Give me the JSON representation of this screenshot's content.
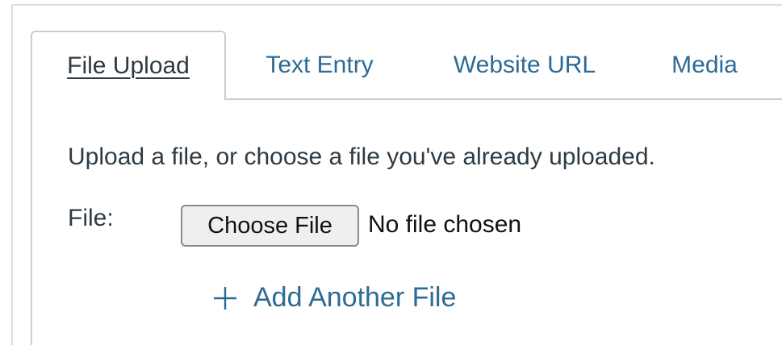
{
  "tabs": [
    {
      "label": "File Upload",
      "active": true
    },
    {
      "label": "Text Entry",
      "active": false
    },
    {
      "label": "Website URL",
      "active": false
    },
    {
      "label": "Media",
      "active": false
    }
  ],
  "upload": {
    "instructions": "Upload a file, or choose a file you've already uploaded.",
    "file_label": "File:",
    "choose_button": "Choose File",
    "no_file_text": "No file chosen",
    "add_another": "Add Another File",
    "add_icon": "plus-icon"
  },
  "colors": {
    "link": "#2d6a94",
    "text": "#2d3b45",
    "border": "#c7cdd1"
  }
}
